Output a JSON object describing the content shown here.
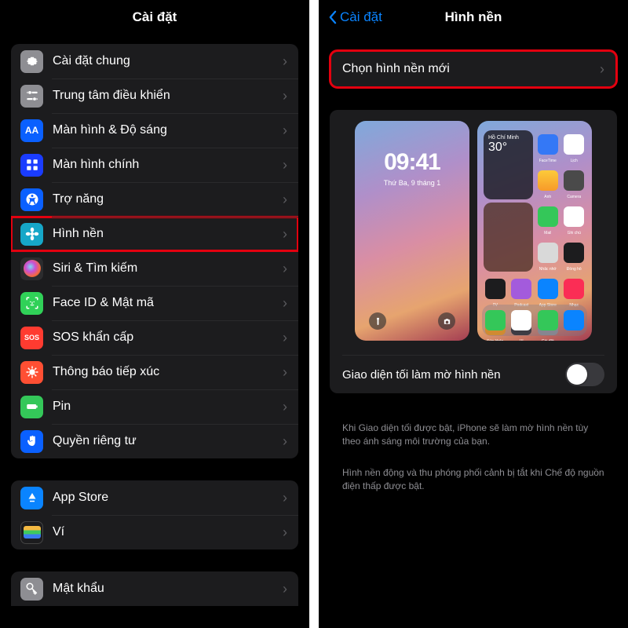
{
  "left": {
    "title": "Cài đặt",
    "groups": [
      {
        "items": [
          {
            "id": "general",
            "label": "Cài đặt chung",
            "iconClass": "ic-gray",
            "iconName": "gear-icon",
            "highlight": false
          },
          {
            "id": "control-center",
            "label": "Trung tâm điều khiển",
            "iconClass": "ic-gray2",
            "iconName": "sliders-icon",
            "highlight": false
          },
          {
            "id": "display",
            "label": "Màn hình & Độ sáng",
            "iconClass": "ic-blueA",
            "iconName": "text-size-icon",
            "highlight": false
          },
          {
            "id": "home-screen",
            "label": "Màn hình chính",
            "iconClass": "ic-darkblue",
            "iconName": "grid-icon",
            "highlight": false
          },
          {
            "id": "accessibility",
            "label": "Trợ năng",
            "iconClass": "ic-blue",
            "iconName": "accessibility-icon",
            "highlight": false
          },
          {
            "id": "wallpaper",
            "label": "Hình nền",
            "iconClass": "ic-cyan",
            "iconName": "flower-icon",
            "highlight": true
          },
          {
            "id": "siri",
            "label": "Siri & Tìm kiếm",
            "iconClass": "ic-black",
            "iconName": "siri-icon",
            "highlight": false
          },
          {
            "id": "faceid",
            "label": "Face ID & Mật mã",
            "iconClass": "ic-green",
            "iconName": "faceid-icon",
            "highlight": false
          },
          {
            "id": "sos",
            "label": "SOS khẩn cấp",
            "iconClass": "ic-red",
            "iconName": "sos-icon",
            "iconText": "SOS",
            "highlight": false
          },
          {
            "id": "exposure",
            "label": "Thông báo tiếp xúc",
            "iconClass": "ic-orange",
            "iconName": "virus-icon",
            "highlight": false
          },
          {
            "id": "battery",
            "label": "Pin",
            "iconClass": "ic-green2",
            "iconName": "battery-icon",
            "highlight": false
          },
          {
            "id": "privacy",
            "label": "Quyền riêng tư",
            "iconClass": "ic-blue",
            "iconName": "hand-icon",
            "highlight": false
          }
        ]
      },
      {
        "items": [
          {
            "id": "appstore",
            "label": "App Store",
            "iconClass": "ic-appstore",
            "iconName": "appstore-icon",
            "highlight": false
          },
          {
            "id": "wallet",
            "label": "Ví",
            "iconClass": "ic-wallet",
            "iconName": "wallet-icon",
            "highlight": false
          }
        ]
      },
      {
        "partial": true,
        "items": [
          {
            "id": "passwords",
            "label": "Mật khẩu",
            "iconClass": "ic-gray",
            "iconName": "key-icon",
            "highlight": false
          }
        ]
      }
    ]
  },
  "right": {
    "back": "Cài đặt",
    "title": "Hình nền",
    "addNew": "Chọn hình nền mới",
    "lock": {
      "time": "09:41",
      "date": "Thứ Ba, 9 tháng 1"
    },
    "home": {
      "widgetCity": "Hồ Chí Minh",
      "widgetTemp": "30°"
    },
    "darkToggle": "Giao diện tối làm mờ hình nền",
    "note1": "Khi Giao diện tối được bật, iPhone sẽ làm mờ hình nền tùy theo ánh sáng môi trường của bạn.",
    "note2": "Hình nền động và thu phóng phối cảnh bị tắt khi Chế độ nguồn điện thấp được bật."
  }
}
